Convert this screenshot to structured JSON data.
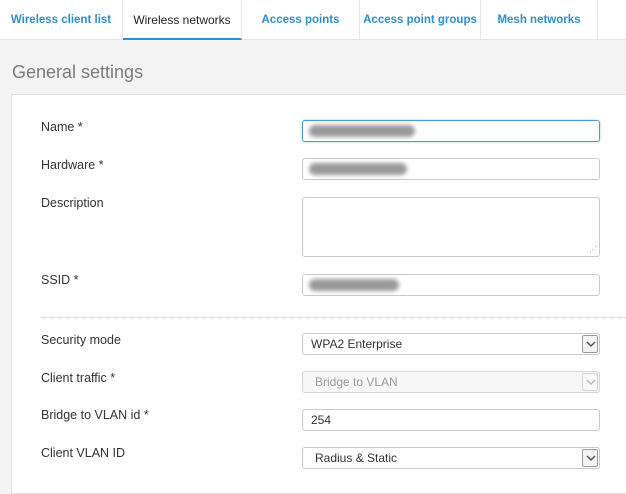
{
  "tabs": [
    {
      "label": "Wireless client list"
    },
    {
      "label": "Wireless networks"
    },
    {
      "label": "Access points"
    },
    {
      "label": "Access point groups"
    },
    {
      "label": "Mesh networks"
    }
  ],
  "colors": {
    "accent": "#2f8fd0"
  },
  "section": {
    "title": "General settings"
  },
  "form": {
    "name_label": "Name *",
    "hardware_label": "Hardware *",
    "description_label": "Description",
    "ssid_label": "SSID *",
    "security_mode_label": "Security mode",
    "security_mode_value": "WPA2 Enterprise",
    "client_traffic_label": "Client traffic *",
    "client_traffic_value": "Bridge to VLAN",
    "bridge_vlan_label": "Bridge to VLAN id *",
    "bridge_vlan_value": "254",
    "client_vlan_label": "Client VLAN ID",
    "client_vlan_value": "Radius & Static"
  }
}
